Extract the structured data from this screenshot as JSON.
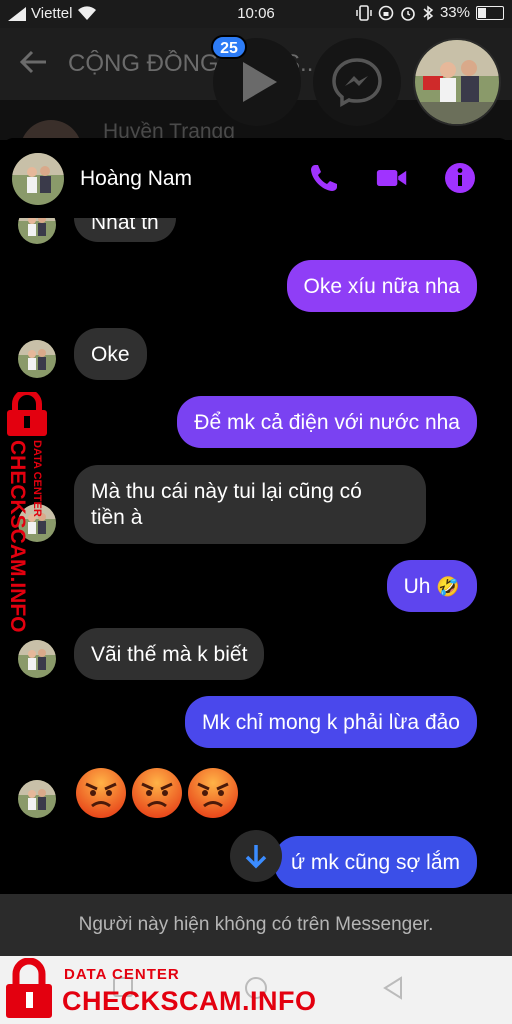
{
  "status_bar": {
    "carrier": "Viettel",
    "time": "10:06",
    "battery": "33%",
    "battery_level": 0.33
  },
  "background": {
    "title": "CỘNG ĐỒNG ... O, S...",
    "row_name": "Huyền Trangg"
  },
  "chat_heads": {
    "badge_count": "25"
  },
  "chat": {
    "contact_name": "Hoàng Nam",
    "icons": {
      "call": "phone-icon",
      "video": "video-camera-icon",
      "info": "info-icon"
    },
    "accent_color": "#a033ff",
    "messages": [
      {
        "from": "them",
        "text": "Nhất th"
      },
      {
        "from": "me",
        "text": "Oke xíu nữa nha"
      },
      {
        "from": "them",
        "text": "Oke"
      },
      {
        "from": "me",
        "text": "Để mk cả điện với nước nha"
      },
      {
        "from": "them",
        "text": "Mà thu cái này tui lại cũng có",
        "text2": "tiền à"
      },
      {
        "from": "me",
        "text": "Uh",
        "emoji": "🤣"
      },
      {
        "from": "them",
        "text": "Vãi thế mà k biết"
      },
      {
        "from": "me",
        "text": "Mk chỉ mong k phải lừa đảo"
      },
      {
        "from": "them",
        "text": "",
        "emoji_count": 3,
        "emoji_name": "angry-face-icon"
      },
      {
        "from": "me",
        "text": "ứ mk cũng sợ lắm"
      }
    ]
  },
  "footer": {
    "notice": "Người này hiện không có trên Messenger."
  },
  "watermark": {
    "small": "DATA CENTER",
    "big": "CHECKSCAM.INFO",
    "color": "#e3000f"
  }
}
